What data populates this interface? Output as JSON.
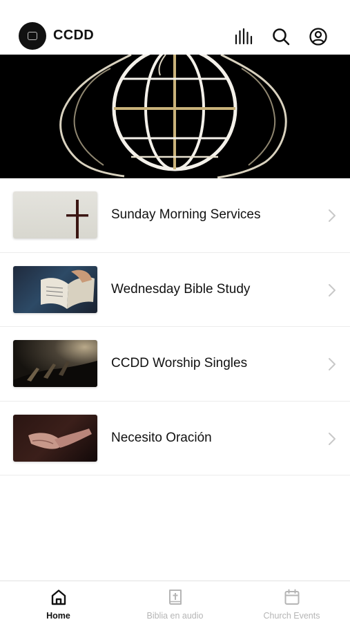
{
  "header": {
    "title": "CCDD",
    "logo_icon": "church-logo-icon",
    "icons": [
      "audio-bars-icon",
      "search-icon",
      "account-icon"
    ]
  },
  "hero": {
    "image": "globe-with-dove-wings"
  },
  "items": [
    {
      "label": "Sunday Morning Services",
      "thumbnail": "cross-image"
    },
    {
      "label": "Wednesday Bible Study",
      "thumbnail": "open-bible-image"
    },
    {
      "label": "CCDD Worship Singles",
      "thumbnail": "raised-hands-image"
    },
    {
      "label": "Necesito Oración",
      "thumbnail": "praying-hands-image"
    }
  ],
  "tabs": [
    {
      "label": "Home",
      "icon": "home-icon",
      "active": true
    },
    {
      "label": "Biblia en audio",
      "icon": "bible-icon",
      "active": false
    },
    {
      "label": "Church Events",
      "icon": "calendar-icon",
      "active": false
    }
  ],
  "colors": {
    "text": "#111111",
    "inactive_tab": "#b5b5b5",
    "divider": "#ececec",
    "hero_bg": "#000000",
    "hero_gold": "#c9b27a"
  }
}
